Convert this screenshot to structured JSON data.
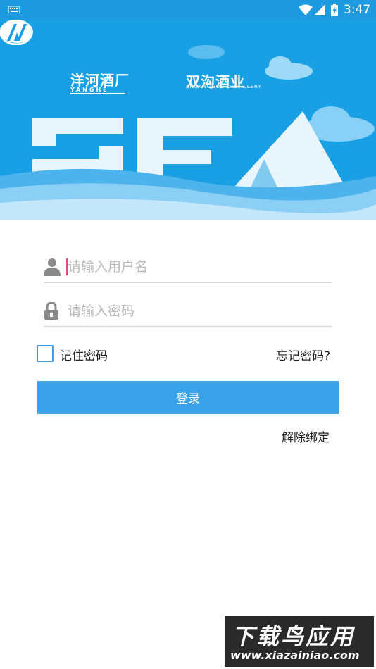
{
  "status_bar": {
    "time": "3:47"
  },
  "banner": {
    "brand1_cn": "洋河酒厂",
    "brand1_en": "YANGHE",
    "brand2_cn": "双沟酒业",
    "brand2_en": "SHUANGGOU DISTILLERY",
    "app_letters": "SFA"
  },
  "form": {
    "username_placeholder": "请输入用户名",
    "password_placeholder": "请输入密码",
    "remember_label": "记住密码",
    "forgot_label": "忘记密码?",
    "login_label": "登录",
    "unbind_label": "解除绑定",
    "remember_checked": false
  },
  "watermark": {
    "title": "下载鸟应用",
    "url": "www.xiazainiao.com"
  },
  "colors": {
    "primary": "#3ba2e9",
    "banner": "#199fe4",
    "caret": "#e14b80"
  }
}
